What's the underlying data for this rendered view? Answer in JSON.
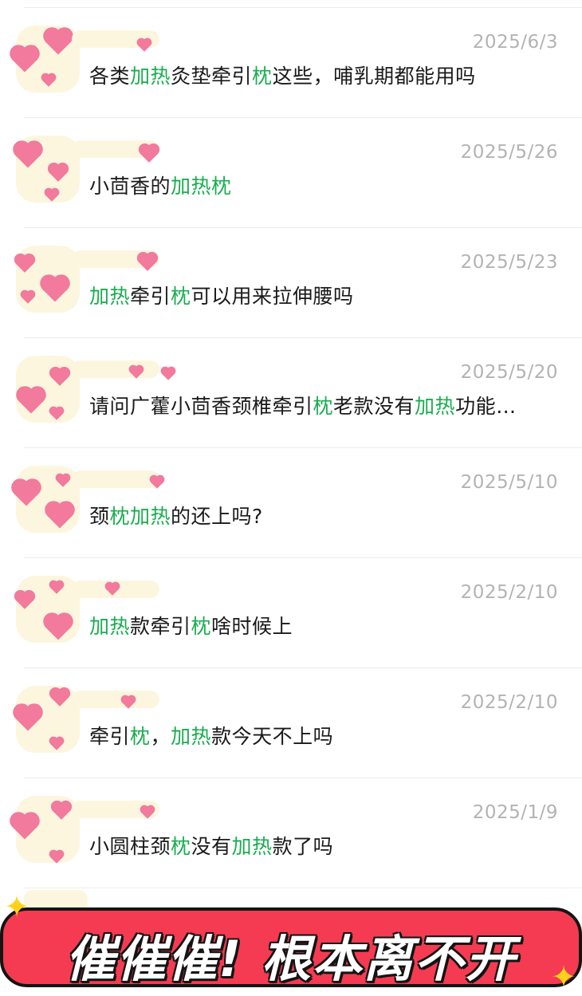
{
  "messages": [
    {
      "date": "2025/6/3",
      "parts": [
        {
          "t": "各类",
          "k": false
        },
        {
          "t": "加热",
          "k": true
        },
        {
          "t": "灸垫牵引",
          "k": false
        },
        {
          "t": "枕",
          "k": true
        },
        {
          "t": "这些，哺乳期都能用吗",
          "k": false
        }
      ]
    },
    {
      "date": "2025/5/26",
      "parts": [
        {
          "t": "小茴香的",
          "k": false
        },
        {
          "t": "加热枕",
          "k": true
        }
      ]
    },
    {
      "date": "2025/5/23",
      "parts": [
        {
          "t": "加热",
          "k": true
        },
        {
          "t": "牵引",
          "k": false
        },
        {
          "t": "枕",
          "k": true
        },
        {
          "t": "可以用来拉伸腰吗",
          "k": false
        }
      ]
    },
    {
      "date": "2025/5/20",
      "parts": [
        {
          "t": "请问广藿小茴香颈椎牵引",
          "k": false
        },
        {
          "t": "枕",
          "k": true
        },
        {
          "t": "老款没有",
          "k": false
        },
        {
          "t": "加热",
          "k": true
        },
        {
          "t": "功能…",
          "k": false
        }
      ]
    },
    {
      "date": "2025/5/10",
      "parts": [
        {
          "t": "颈",
          "k": false
        },
        {
          "t": "枕加热",
          "k": true
        },
        {
          "t": "的还上吗?",
          "k": false
        }
      ]
    },
    {
      "date": "2025/2/10",
      "parts": [
        {
          "t": "加热",
          "k": true
        },
        {
          "t": "款牵引",
          "k": false
        },
        {
          "t": "枕",
          "k": true
        },
        {
          "t": "啥时候上",
          "k": false
        }
      ]
    },
    {
      "date": "2025/2/10",
      "parts": [
        {
          "t": "牵引",
          "k": false
        },
        {
          "t": "枕",
          "k": true
        },
        {
          "t": "，",
          "k": false
        },
        {
          "t": "加热",
          "k": true
        },
        {
          "t": "款今天不上吗",
          "k": false
        }
      ]
    },
    {
      "date": "2025/1/9",
      "parts": [
        {
          "t": "小圆柱颈",
          "k": false
        },
        {
          "t": "枕",
          "k": true
        },
        {
          "t": "没有",
          "k": false
        },
        {
          "t": "加热",
          "k": true
        },
        {
          "t": "款了吗",
          "k": false
        }
      ]
    }
  ],
  "banner": {
    "text": "催催催!  根本离不开"
  },
  "colors": {
    "keyword": "#1aad50",
    "banner": "#f53b52",
    "date": "#b3b3b3"
  },
  "icons": {
    "avatar": "heart-sticker-avatar",
    "sparkle": "sparkle-icon"
  }
}
